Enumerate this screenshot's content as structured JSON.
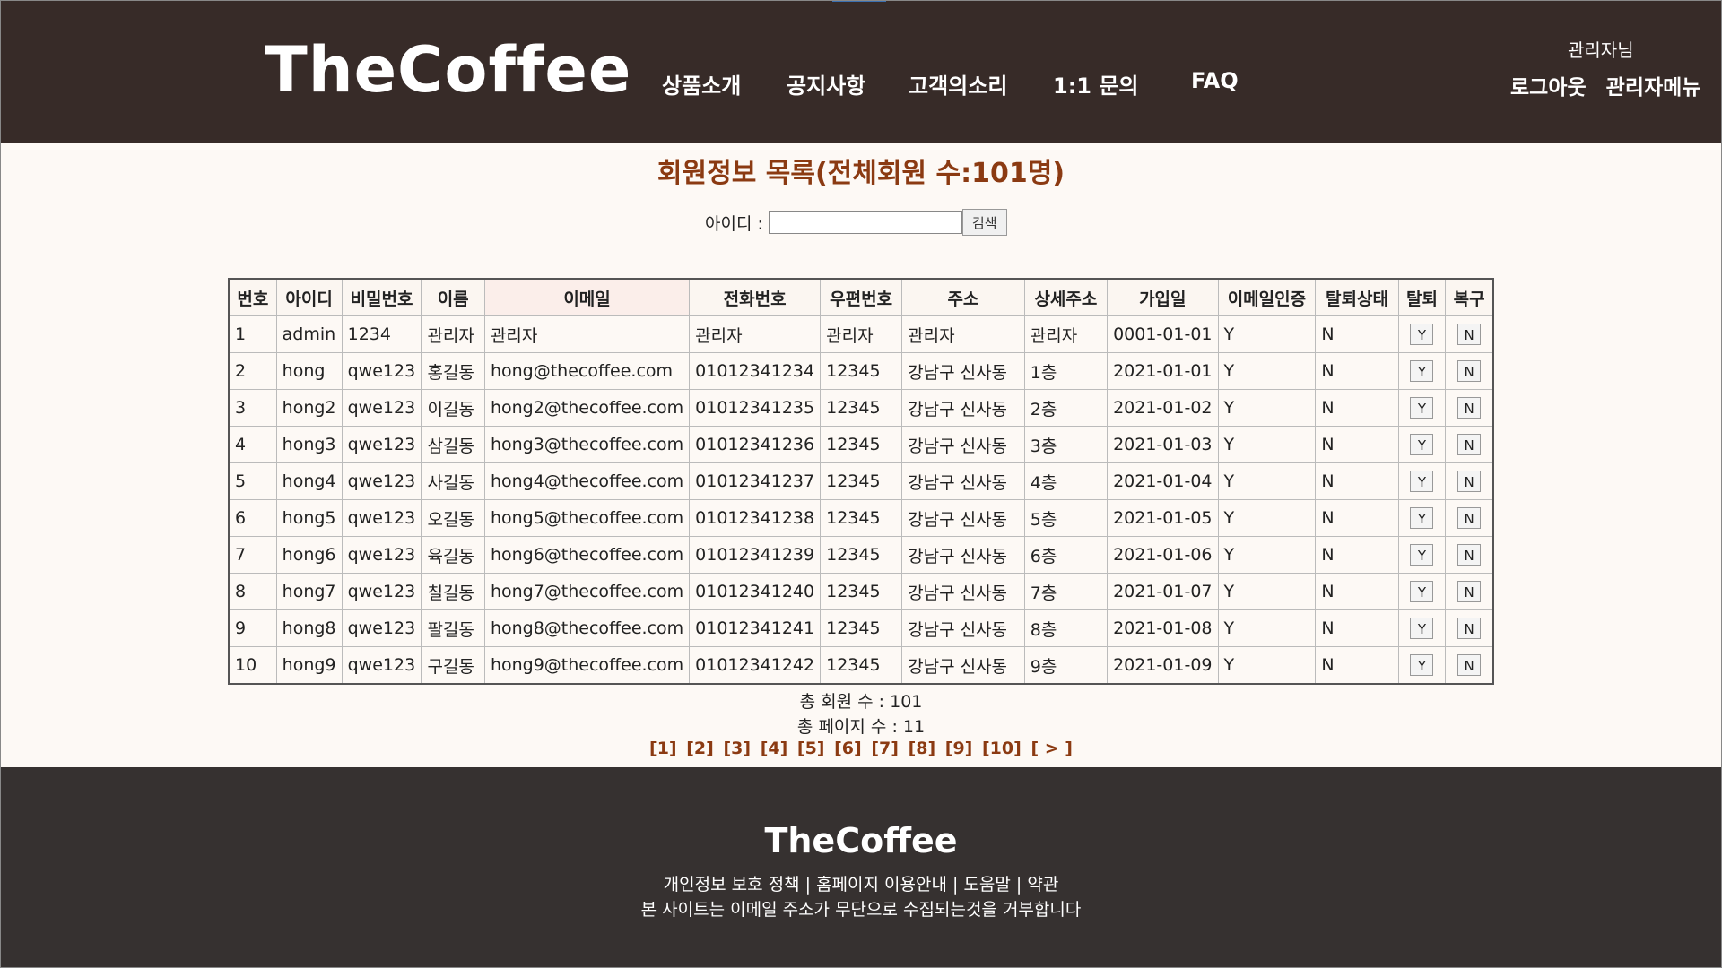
{
  "header": {
    "logo": "TheCoffee",
    "nav": [
      "상품소개",
      "공지사항",
      "고객의소리",
      "1:1 문의",
      "FAQ"
    ],
    "greeting": "관리자님",
    "logout": "로그아웃",
    "admin_menu": "관리자메뉴"
  },
  "main": {
    "title": "회원정보 목록(전체회원 수:101명)",
    "search": {
      "label": "아이디 :",
      "value": "",
      "button": "검색"
    },
    "columns": [
      "번호",
      "아이디",
      "비밀번호",
      "이름",
      "이메일",
      "전화번호",
      "우편번호",
      "주소",
      "상세주소",
      "가입일",
      "이메일인증",
      "탈퇴상태",
      "탈퇴",
      "복구"
    ],
    "rows": [
      [
        "1",
        "admin",
        "1234",
        "관리자",
        "관리자",
        "관리자",
        "관리자",
        "관리자",
        "관리자",
        "0001-01-01",
        "Y",
        "N",
        "Y",
        "N"
      ],
      [
        "2",
        "hong",
        "qwe123",
        "홍길동",
        "hong@thecoffee.com",
        "01012341234",
        "12345",
        "강남구 신사동",
        "1층",
        "2021-01-01",
        "Y",
        "N",
        "Y",
        "N"
      ],
      [
        "3",
        "hong2",
        "qwe123",
        "이길동",
        "hong2@thecoffee.com",
        "01012341235",
        "12345",
        "강남구 신사동",
        "2층",
        "2021-01-02",
        "Y",
        "N",
        "Y",
        "N"
      ],
      [
        "4",
        "hong3",
        "qwe123",
        "삼길동",
        "hong3@thecoffee.com",
        "01012341236",
        "12345",
        "강남구 신사동",
        "3층",
        "2021-01-03",
        "Y",
        "N",
        "Y",
        "N"
      ],
      [
        "5",
        "hong4",
        "qwe123",
        "사길동",
        "hong4@thecoffee.com",
        "01012341237",
        "12345",
        "강남구 신사동",
        "4층",
        "2021-01-04",
        "Y",
        "N",
        "Y",
        "N"
      ],
      [
        "6",
        "hong5",
        "qwe123",
        "오길동",
        "hong5@thecoffee.com",
        "01012341238",
        "12345",
        "강남구 신사동",
        "5층",
        "2021-01-05",
        "Y",
        "N",
        "Y",
        "N"
      ],
      [
        "7",
        "hong6",
        "qwe123",
        "육길동",
        "hong6@thecoffee.com",
        "01012341239",
        "12345",
        "강남구 신사동",
        "6층",
        "2021-01-06",
        "Y",
        "N",
        "Y",
        "N"
      ],
      [
        "8",
        "hong7",
        "qwe123",
        "칠길동",
        "hong7@thecoffee.com",
        "01012341240",
        "12345",
        "강남구 신사동",
        "7층",
        "2021-01-07",
        "Y",
        "N",
        "Y",
        "N"
      ],
      [
        "9",
        "hong8",
        "qwe123",
        "팔길동",
        "hong8@thecoffee.com",
        "01012341241",
        "12345",
        "강남구 신사동",
        "8층",
        "2021-01-08",
        "Y",
        "N",
        "Y",
        "N"
      ],
      [
        "10",
        "hong9",
        "qwe123",
        "구길동",
        "hong9@thecoffee.com",
        "01012341242",
        "12345",
        "강남구 신사동",
        "9층",
        "2021-01-09",
        "Y",
        "N",
        "Y",
        "N"
      ]
    ],
    "total_members": "총 회원 수 : 101",
    "total_pages": "총 페이지 수 : 11",
    "pages": [
      "[1]",
      "[2]",
      "[3]",
      "[4]",
      "[5]",
      "[6]",
      "[7]",
      "[8]",
      "[9]",
      "[10]",
      "[ > ]"
    ]
  },
  "footer": {
    "logo": "TheCoffee",
    "links": [
      "개인정보 보호 정책",
      "홈페이지 이용안내",
      "도움말",
      "약관"
    ],
    "separator": " | ",
    "note": "본 사이트는 이메일 주소가 무단으로 수집되는것을 거부합니다"
  },
  "colors": {
    "header_bg": "#372b28",
    "footer_bg": "#363130",
    "title": "#8b3a12",
    "page_bg": "#fdf9f5"
  }
}
